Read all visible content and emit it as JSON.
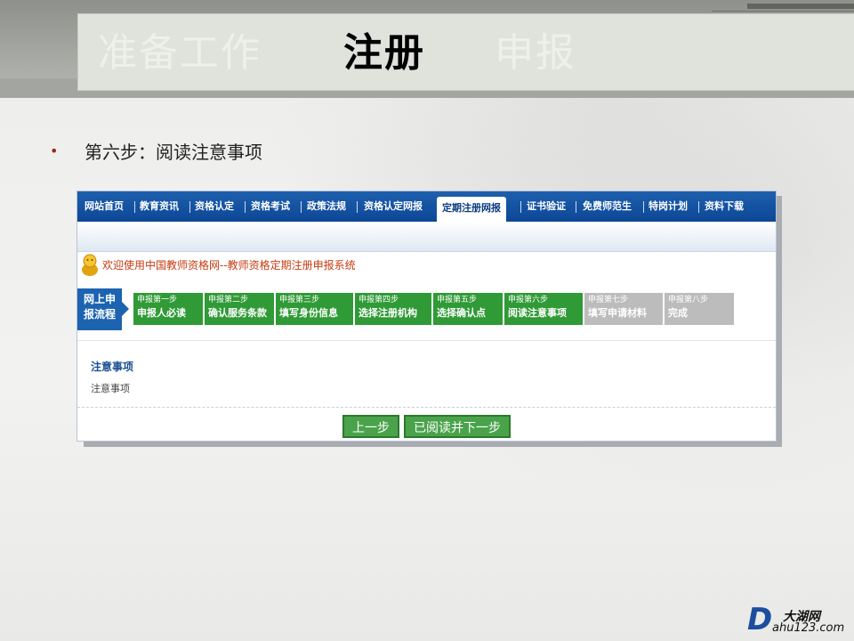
{
  "slide": {
    "title_left": "准备工作",
    "title_main": "注册",
    "title_right": "申报",
    "bullet_symbol": "•",
    "step_heading": "第六步：阅读注意事项"
  },
  "site": {
    "nav": [
      "网站首页",
      "教育资讯",
      "资格认定",
      "资格考试",
      "政策法规",
      "资格认定网报",
      "定期注册网报",
      "证书验证",
      "免费师范生",
      "特岗计划",
      "资料下载"
    ],
    "nav_active": "定期注册网报",
    "welcome": "欢迎使用中国教师资格网--教师资格定期注册申报系统",
    "steps_start": [
      "网上申",
      "报流程"
    ],
    "steps": [
      {
        "no": "申报第一步",
        "name": "申报人必读",
        "done": true
      },
      {
        "no": "申报第二步",
        "name": "确认服务条款",
        "done": true
      },
      {
        "no": "申报第三步",
        "name": "填写身份信息",
        "done": true
      },
      {
        "no": "申报第四步",
        "name": "选择注册机构",
        "done": true
      },
      {
        "no": "申报第五步",
        "name": "选择确认点",
        "done": true
      },
      {
        "no": "申报第六步",
        "name": "阅读注意事项",
        "done": true
      },
      {
        "no": "申报第七步",
        "name": "填写申请材料",
        "done": false
      },
      {
        "no": "申报第八步",
        "name": "完成",
        "done": false
      }
    ],
    "notice_title": "注意事项",
    "notice_text": "注意事项",
    "btn_prev": "上一步",
    "btn_next": "已阅读并下一步"
  },
  "logo": {
    "letter": "D",
    "name": "大湖网",
    "url": "ahu123.com"
  },
  "colors": {
    "nav_blue": "#0d4796",
    "step_done": "#2f9a36",
    "step_todo": "#bcbcbc",
    "welcome_red": "#c83a12"
  }
}
